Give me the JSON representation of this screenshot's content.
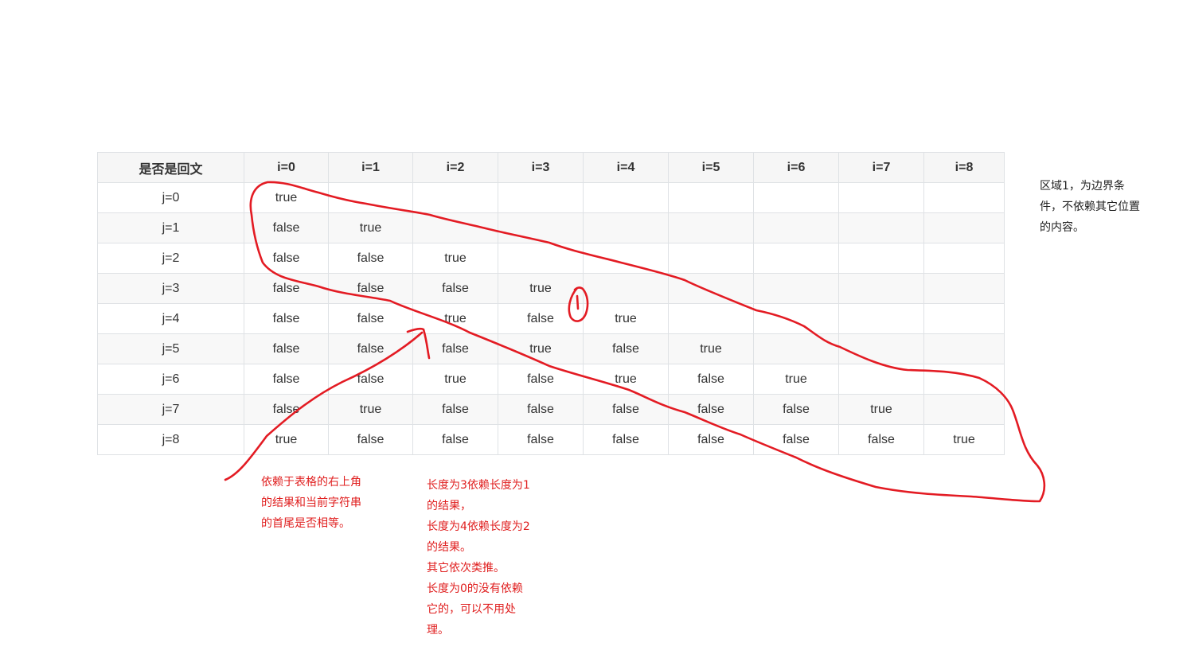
{
  "table": {
    "corner_header": "是否是回文",
    "columns": [
      "i=0",
      "i=1",
      "i=2",
      "i=3",
      "i=4",
      "i=5",
      "i=6",
      "i=7",
      "i=8"
    ],
    "rows": [
      {
        "label": "j=0",
        "cells": [
          "true",
          "",
          "",
          "",
          "",
          "",
          "",
          "",
          ""
        ]
      },
      {
        "label": "j=1",
        "cells": [
          "false",
          "true",
          "",
          "",
          "",
          "",
          "",
          "",
          ""
        ]
      },
      {
        "label": "j=2",
        "cells": [
          "false",
          "false",
          "true",
          "",
          "",
          "",
          "",
          "",
          ""
        ]
      },
      {
        "label": "j=3",
        "cells": [
          "false",
          "false",
          "false",
          "true",
          "",
          "",
          "",
          "",
          ""
        ]
      },
      {
        "label": "j=4",
        "cells": [
          "false",
          "false",
          "true",
          "false",
          "true",
          "",
          "",
          "",
          ""
        ]
      },
      {
        "label": "j=5",
        "cells": [
          "false",
          "false",
          "false",
          "true",
          "false",
          "true",
          "",
          "",
          ""
        ]
      },
      {
        "label": "j=6",
        "cells": [
          "false",
          "false",
          "true",
          "false",
          "true",
          "false",
          "true",
          "",
          ""
        ]
      },
      {
        "label": "j=7",
        "cells": [
          "false",
          "true",
          "false",
          "false",
          "false",
          "false",
          "false",
          "true",
          ""
        ]
      },
      {
        "label": "j=8",
        "cells": [
          "true",
          "false",
          "false",
          "false",
          "false",
          "false",
          "false",
          "false",
          "true"
        ]
      }
    ]
  },
  "annotations": {
    "region_note": "区域1，为边界条\n件，不依赖其它位置\n的内容。",
    "dependency_note": "依赖于表格的右上角\n的结果和当前字符串\n的首尾是否相等。",
    "length_note": "长度为3依赖长度为1\n的结果，\n长度为4依赖长度为2\n的结果。\n其它依次类推。\n长度为0的没有依赖\n它的，可以不用处\n理。",
    "handwritten_mark": "1"
  },
  "colors": {
    "ink": "#e31b23",
    "header_bg": "#f6f6f6",
    "stripe_bg": "#f8f8f8",
    "border": "#dfe2e5"
  }
}
